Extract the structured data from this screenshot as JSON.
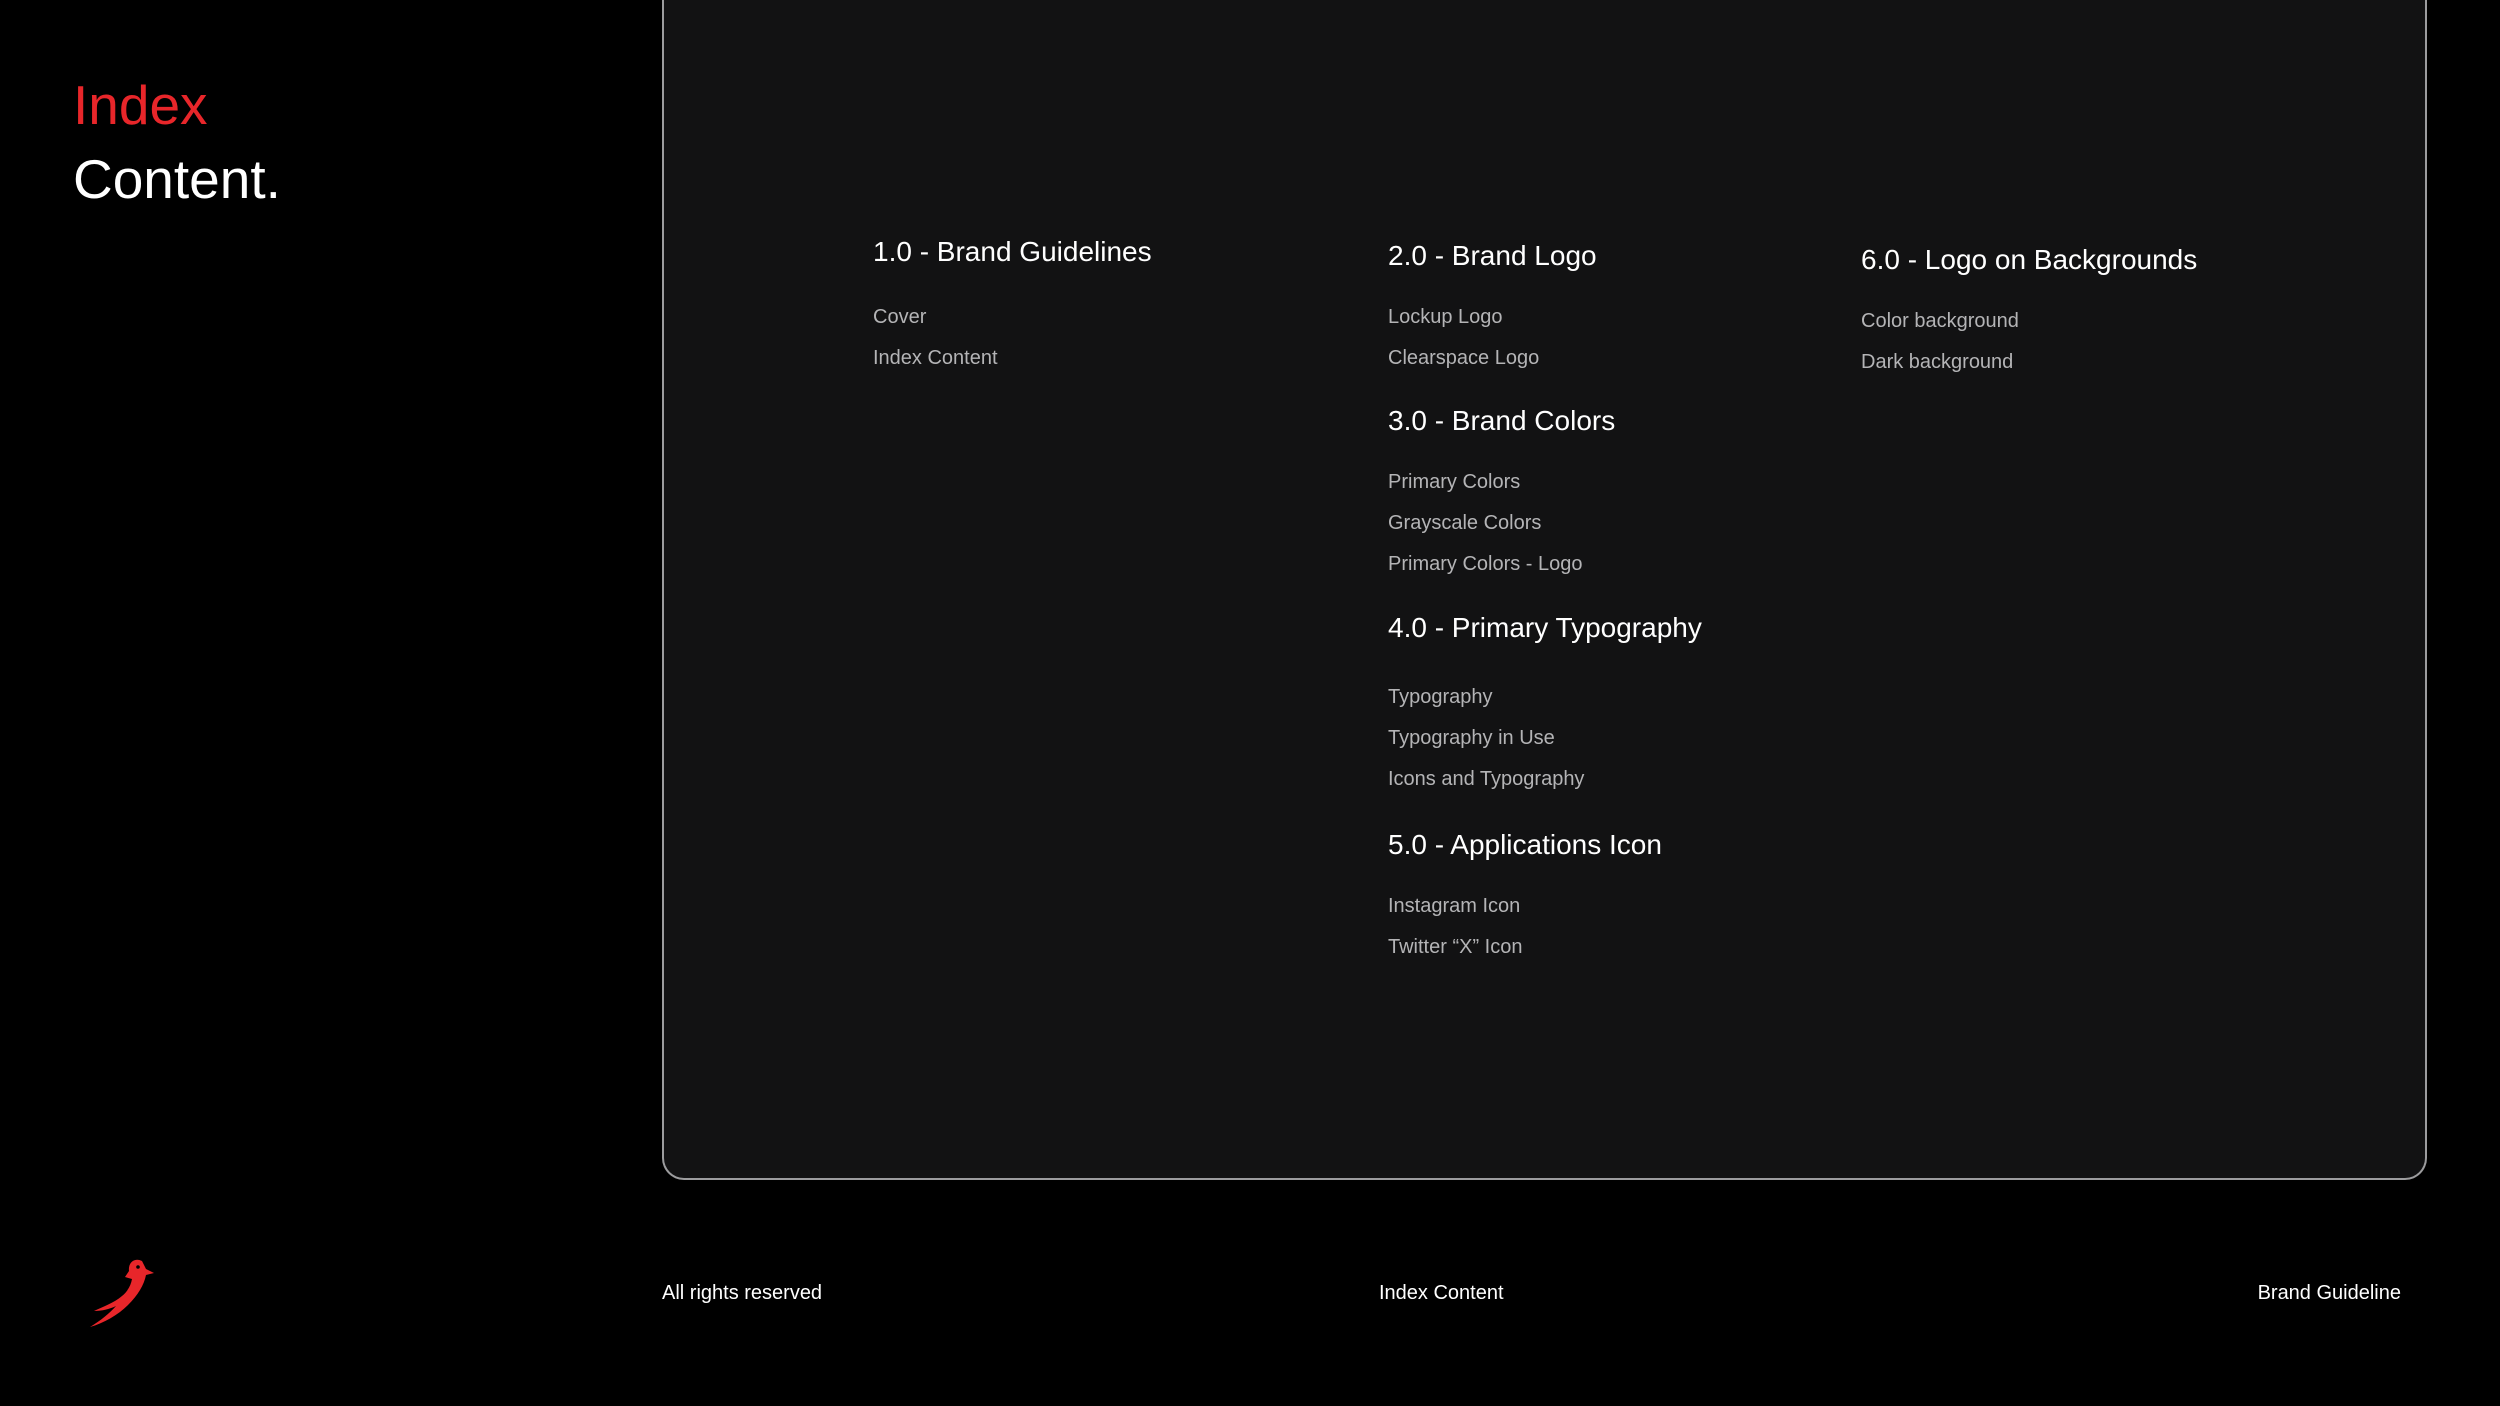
{
  "header": {
    "accent": "Index",
    "main": "Content."
  },
  "sections": [
    {
      "title": "1.0 - Brand Guidelines",
      "items": [
        "Cover",
        "Index Content"
      ]
    },
    {
      "title": "2.0 - Brand Logo",
      "items": [
        "Lockup Logo",
        "Clearspace Logo"
      ]
    },
    {
      "title": "3.0 - Brand Colors",
      "items": [
        "Primary Colors",
        "Grayscale Colors",
        "Primary Colors - Logo"
      ]
    },
    {
      "title": "4.0 - Primary Typography",
      "items": [
        "Typography",
        "Typography in Use",
        "Icons and Typography"
      ]
    },
    {
      "title": "5.0 - Applications Icon",
      "items": [
        "Instagram Icon",
        "Twitter “X”  Icon"
      ]
    },
    {
      "title": "6.0 - Logo on Backgrounds",
      "items": [
        "Color background",
        "Dark background"
      ]
    }
  ],
  "footer": {
    "left": "All rights reserved",
    "center": "Index Content",
    "right": "Brand Guideline"
  },
  "colors": {
    "accent": "#e8262a",
    "background": "#000000",
    "panel": "#121213",
    "panel_border": "#9c9c9e"
  },
  "icons": {
    "brand_logo": "cardinal-bird-icon"
  }
}
